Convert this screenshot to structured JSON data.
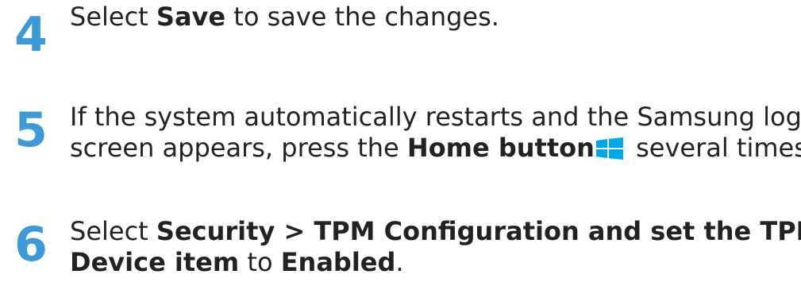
{
  "colors": {
    "step_number": "#3d9ad6",
    "text": "#222222",
    "home_icon": "#00a8e8"
  },
  "steps": [
    {
      "number": "4",
      "lines": [
        {
          "t1": "Select ",
          "b1": "Save",
          "t2": " to save the changes."
        }
      ]
    },
    {
      "number": "5",
      "lines": [
        {
          "t1": "If the system automatically restarts and the Samsung logo"
        },
        {
          "t1": "screen appears, press the ",
          "b1": "Home button",
          "t2": " several times.",
          "icon": "windows-logo-icon"
        }
      ]
    },
    {
      "number": "6",
      "lines": [
        {
          "t1": "Select ",
          "b1": "Security > TPM Configuration and set the TPM"
        },
        {
          "b1": "Device item",
          "t2": " to ",
          "b2": "Enabled",
          "t3": "."
        }
      ]
    }
  ]
}
